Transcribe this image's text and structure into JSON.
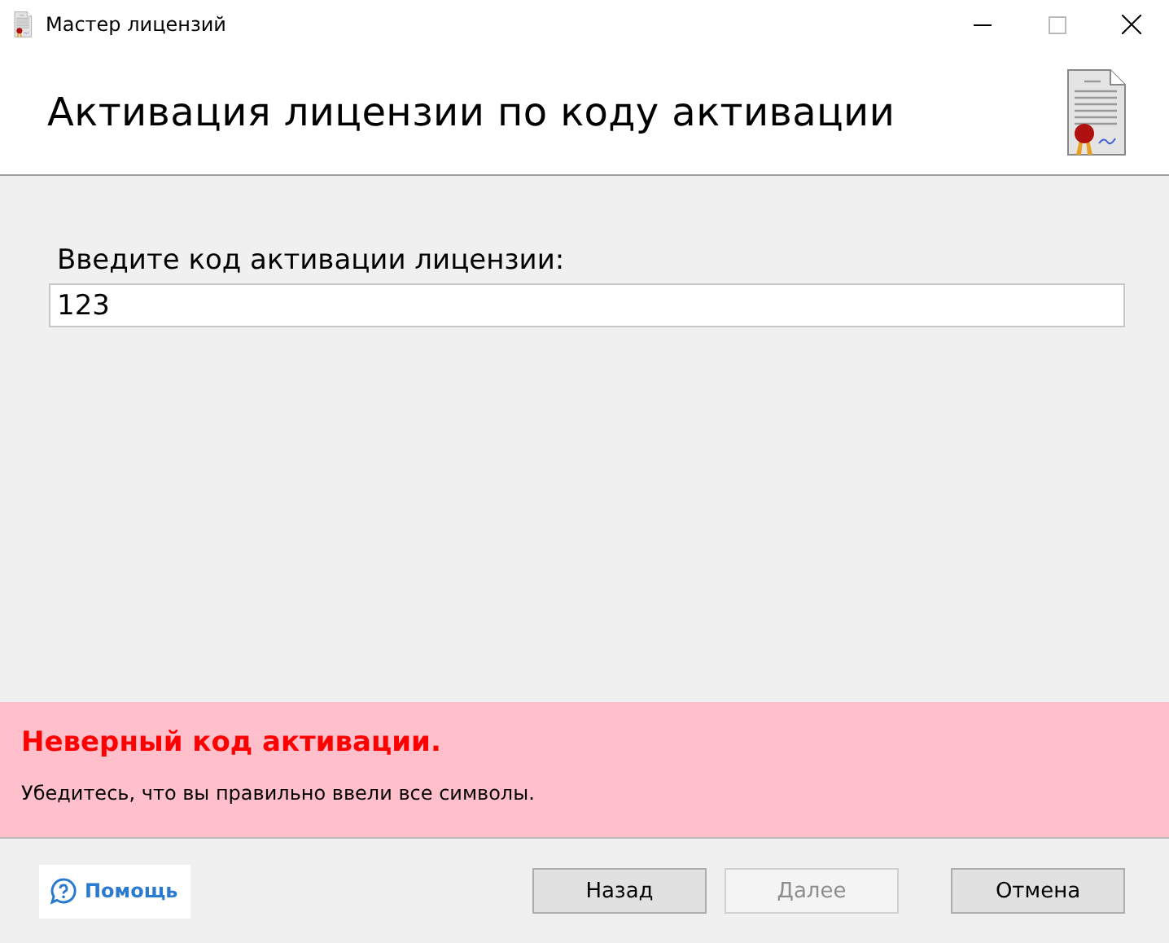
{
  "window": {
    "title": "Мастер лицензий"
  },
  "header": {
    "title": "Активация лицензии по коду активации"
  },
  "form": {
    "label": "Введите код активации лицензии:",
    "value": "123"
  },
  "error": {
    "title": "Неверный код активации.",
    "message": "Убедитесь, что вы правильно ввели все символы."
  },
  "help_link": {
    "label": "Помощь"
  },
  "buttons": [
    {
      "label": "Назад",
      "disabled": false
    },
    {
      "label": "Далее",
      "disabled": true
    },
    {
      "label": "Отмена",
      "disabled": false
    }
  ]
}
